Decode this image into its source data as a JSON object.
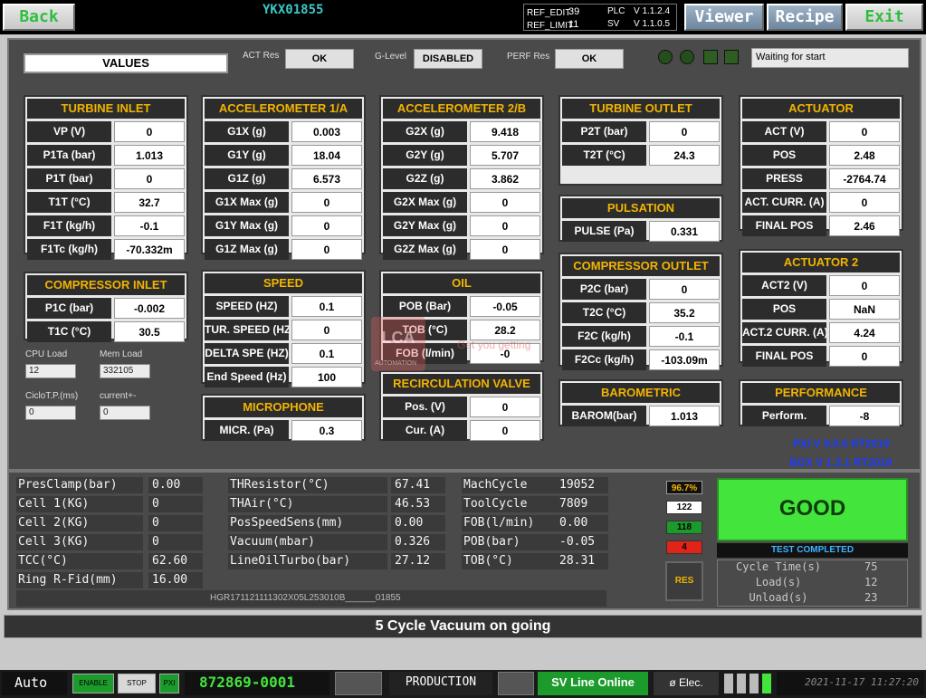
{
  "topbar": {
    "back": "Back",
    "machine_id": "YKX01855",
    "ref_edit_label": "REF_EDIT",
    "ref_edit_val": "39",
    "ref_limit_label": "REF_LIMIT",
    "ref_limit_val": "11",
    "plc_label": "PLC",
    "plc_ver": "V 1.1.2.4",
    "sv_label": "SV",
    "sv_ver": "V 1.1.0.5",
    "viewer": "Viewer",
    "recipe": "Recipe",
    "exit": "Exit"
  },
  "header": {
    "values": "VALUES",
    "act_res_label": "ACT Res",
    "act_res": "OK",
    "glevel_label": "G-Level",
    "glevel": "DISABLED",
    "perf_res_label": "PERF Res",
    "perf_res": "OK",
    "status_msg": "Waiting for start"
  },
  "turbine_inlet": {
    "title": "TURBINE INLET",
    "rows": [
      {
        "l": "VP (V)",
        "v": "0"
      },
      {
        "l": "P1Ta (bar)",
        "v": "1.013"
      },
      {
        "l": "P1T (bar)",
        "v": "0"
      },
      {
        "l": "T1T (°C)",
        "v": "32.7"
      },
      {
        "l": "F1T (kg/h)",
        "v": "-0.1"
      },
      {
        "l": "F1Tc (kg/h)",
        "v": "-70.332m"
      }
    ]
  },
  "acc1": {
    "title": "ACCELEROMETER 1/A",
    "rows": [
      {
        "l": "G1X (g)",
        "v": "0.003"
      },
      {
        "l": "G1Y (g)",
        "v": "18.04"
      },
      {
        "l": "G1Z (g)",
        "v": "6.573"
      },
      {
        "l": "G1X Max (g)",
        "v": "0"
      },
      {
        "l": "G1Y Max (g)",
        "v": "0"
      },
      {
        "l": "G1Z Max (g)",
        "v": "0"
      }
    ]
  },
  "acc2": {
    "title": "ACCELEROMETER 2/B",
    "rows": [
      {
        "l": "G2X (g)",
        "v": "9.418"
      },
      {
        "l": "G2Y (g)",
        "v": "5.707"
      },
      {
        "l": "G2Z (g)",
        "v": "3.862"
      },
      {
        "l": "G2X Max (g)",
        "v": "0"
      },
      {
        "l": "G2Y Max (g)",
        "v": "0"
      },
      {
        "l": "G2Z Max (g)",
        "v": "0"
      }
    ]
  },
  "turbine_outlet": {
    "title": "TURBINE OUTLET",
    "rows": [
      {
        "l": "P2T (bar)",
        "v": "0"
      },
      {
        "l": "T2T (°C)",
        "v": "24.3"
      }
    ]
  },
  "actuator": {
    "title": "ACTUATOR",
    "rows": [
      {
        "l": "ACT (V)",
        "v": "0"
      },
      {
        "l": "POS",
        "v": "2.48"
      },
      {
        "l": "PRESS",
        "v": "-2764.74"
      },
      {
        "l": "ACT. CURR. (A)",
        "v": "0"
      },
      {
        "l": "FINAL POS",
        "v": "2.46"
      }
    ]
  },
  "pulsation": {
    "title": "PULSATION",
    "rows": [
      {
        "l": "PULSE (Pa)",
        "v": "0.331"
      }
    ]
  },
  "compressor_inlet": {
    "title": "COMPRESSOR INLET",
    "rows": [
      {
        "l": "P1C (bar)",
        "v": "-0.002"
      },
      {
        "l": "T1C (°C)",
        "v": "30.5"
      }
    ]
  },
  "speed": {
    "title": "SPEED",
    "rows": [
      {
        "l": "SPEED (HZ)",
        "v": "0.1"
      },
      {
        "l": "TUR. SPEED (HZ)",
        "v": "0"
      },
      {
        "l": "DELTA SPE (HZ)",
        "v": "0.1"
      },
      {
        "l": "End Speed (Hz)",
        "v": "100"
      }
    ]
  },
  "oil": {
    "title": "OIL",
    "rows": [
      {
        "l": "POB (Bar)",
        "v": "-0.05"
      },
      {
        "l": "TOB (°C)",
        "v": "28.2"
      },
      {
        "l": "FOB (l/min)",
        "v": "-0"
      }
    ]
  },
  "compressor_outlet": {
    "title": "COMPRESSOR OUTLET",
    "rows": [
      {
        "l": "P2C (bar)",
        "v": "0"
      },
      {
        "l": "T2C (°C)",
        "v": "35.2"
      },
      {
        "l": "F2C (kg/h)",
        "v": "-0.1"
      },
      {
        "l": "F2Cc (kg/h)",
        "v": "-103.09m"
      }
    ]
  },
  "actuator2": {
    "title": "ACTUATOR 2",
    "rows": [
      {
        "l": "ACT2 (V)",
        "v": "0"
      },
      {
        "l": "POS",
        "v": "NaN"
      },
      {
        "l": "ACT.2 CURR. (A)",
        "v": "4.24"
      },
      {
        "l": "FINAL POS",
        "v": "0"
      }
    ]
  },
  "recirc": {
    "title": "RECIRCULATION VALVE",
    "rows": [
      {
        "l": "Pos. (V)",
        "v": "0"
      },
      {
        "l": "Cur. (A)",
        "v": "0"
      }
    ]
  },
  "microphone": {
    "title": "MICROPHONE",
    "rows": [
      {
        "l": "MICR. (Pa)",
        "v": "0.3"
      }
    ]
  },
  "barometric": {
    "title": "BAROMETRIC",
    "rows": [
      {
        "l": "BAROM(bar)",
        "v": "1.013"
      }
    ]
  },
  "performance": {
    "title": "PERFORMANCE",
    "rows": [
      {
        "l": "Perform.",
        "v": "-8"
      }
    ]
  },
  "sys": {
    "cpu_label": "CPU Load",
    "cpu": "12",
    "mem_label": "Mem Load",
    "mem": "332105",
    "ciclo_label": "CicloT.P.(ms)",
    "ciclo": "0",
    "current_label": "current+-",
    "current": "0",
    "pxi_ver": "PXI V 9.0.5 RT2019",
    "box_ver": "BOX V 1.3.1 RT2019"
  },
  "data_col1": [
    {
      "l": "PresClamp(bar)",
      "v": "0.00"
    },
    {
      "l": "Cell 1(KG)",
      "v": "0"
    },
    {
      "l": "Cell 2(KG)",
      "v": "0"
    },
    {
      "l": "Cell 3(KG)",
      "v": "0"
    },
    {
      "l": "TCC(°C)",
      "v": "62.60"
    },
    {
      "l": "Ring R-Fid(mm)",
      "v": "16.00"
    }
  ],
  "data_col2": [
    {
      "l": "THResistor(°C)",
      "v": "67.41"
    },
    {
      "l": "THAir(°C)",
      "v": "46.53"
    },
    {
      "l": "PosSpeedSens(mm)",
      "v": "0.00"
    },
    {
      "l": "Vacuum(mbar)",
      "v": "0.326"
    },
    {
      "l": "LineOilTurbo(bar)",
      "v": "27.12"
    }
  ],
  "data_col3": [
    {
      "l": "MachCycle",
      "v": "19052"
    },
    {
      "l": "ToolCycle",
      "v": "7809"
    },
    {
      "l": "FOB(l/min)",
      "v": "0.00"
    },
    {
      "l": "POB(bar)",
      "v": "-0.05"
    },
    {
      "l": "TOB(°C)",
      "v": "28.31"
    }
  ],
  "counters": {
    "pct": "96.7%",
    "total": "122",
    "good": "118",
    "bad": "4",
    "res": "RES"
  },
  "result": {
    "label": "GOOD",
    "sub": "TEST COMPLETED",
    "cycle_time_label": "Cycle Time(s)",
    "cycle_time": "75",
    "load_label": "Load(s)",
    "load": "12",
    "unload_label": "Unload(s)",
    "unload": "23"
  },
  "barcode": "HGR171121111302X05L253010B______01855",
  "status_msg": "5 Cycle Vacuum on going",
  "bottom": {
    "mode": "Auto",
    "enable": "ENABLE",
    "stop": "STOP",
    "pxi": "PXI",
    "serial": "872869-0001",
    "production": "PRODUCTION",
    "sv_online": "SV Line Online",
    "elec": "ø Elec.",
    "datetime": "2021-11-17 11:27:20"
  },
  "watermark": {
    "logo": "LCA",
    "tag": "AUTOMATION",
    "slogan": "Get you getting"
  }
}
